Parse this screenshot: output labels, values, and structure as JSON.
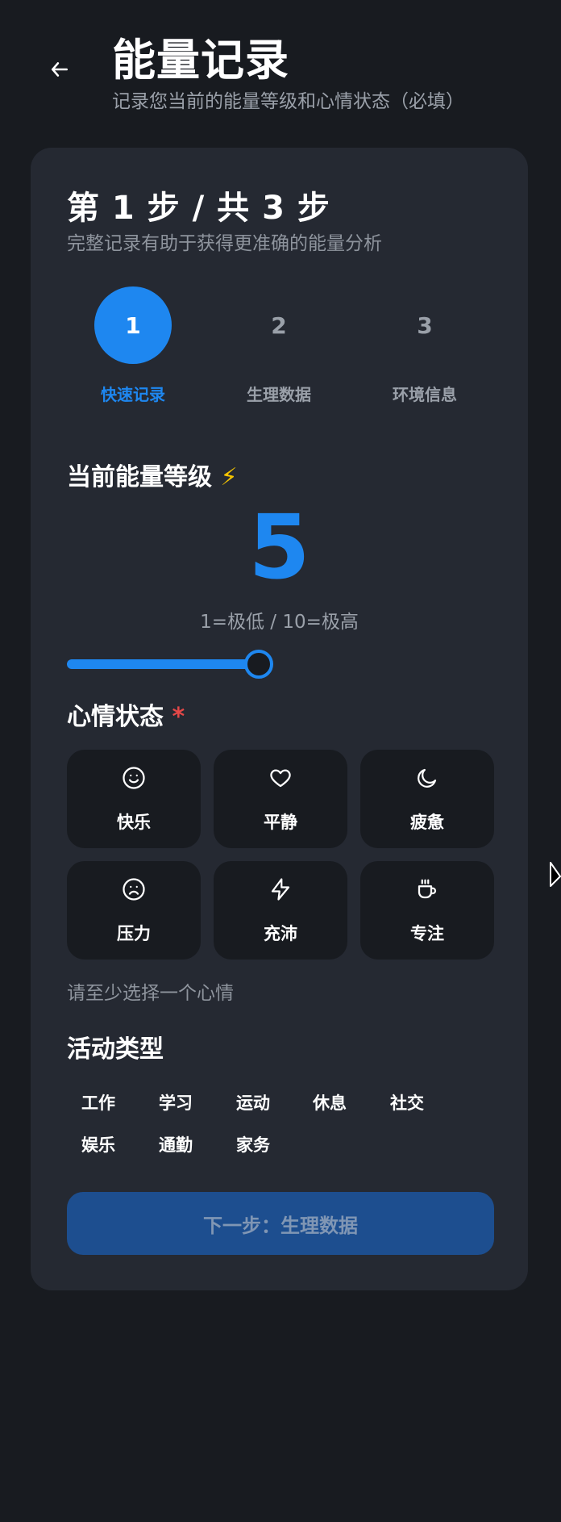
{
  "header": {
    "back_icon": "arrow-left-icon",
    "title": "能量记录",
    "subtitle": "记录您当前的能量等级和心情状态（必填）"
  },
  "card": {
    "step_title": "第 1 步 / 共 3 步",
    "step_subtitle": "完整记录有助于获得更准确的能量分析"
  },
  "stepper": {
    "active_index": 0,
    "steps": [
      {
        "number": "1",
        "label": "快速记录"
      },
      {
        "number": "2",
        "label": "生理数据"
      },
      {
        "number": "3",
        "label": "环境信息"
      }
    ]
  },
  "energy": {
    "label": "当前能量等级",
    "emoji": "⚡",
    "value": "5",
    "hint": "1=极低 / 10=极高",
    "slider_value": 5,
    "slider_min": 1,
    "slider_max": 10
  },
  "mood": {
    "label": "心情状态",
    "required_mark": "*",
    "options": [
      {
        "label": "快乐",
        "icon": "smile-icon"
      },
      {
        "label": "平静",
        "icon": "heart-icon"
      },
      {
        "label": "疲惫",
        "icon": "moon-icon"
      },
      {
        "label": "压力",
        "icon": "frown-icon"
      },
      {
        "label": "充沛",
        "icon": "lightning-icon"
      },
      {
        "label": "专注",
        "icon": "coffee-icon"
      }
    ],
    "hint": "请至少选择一个心情"
  },
  "activity": {
    "label": "活动类型",
    "options": [
      "工作",
      "学习",
      "运动",
      "休息",
      "社交",
      "娱乐",
      "通勤",
      "家务"
    ]
  },
  "next_button": {
    "label": "下一步：生理数据"
  },
  "colors": {
    "background": "#181b20",
    "card": "#252932",
    "accent": "#1e87f0",
    "muted": "#9aa0a9",
    "required": "#e54848",
    "button_disabled": "#1d4e8f"
  }
}
